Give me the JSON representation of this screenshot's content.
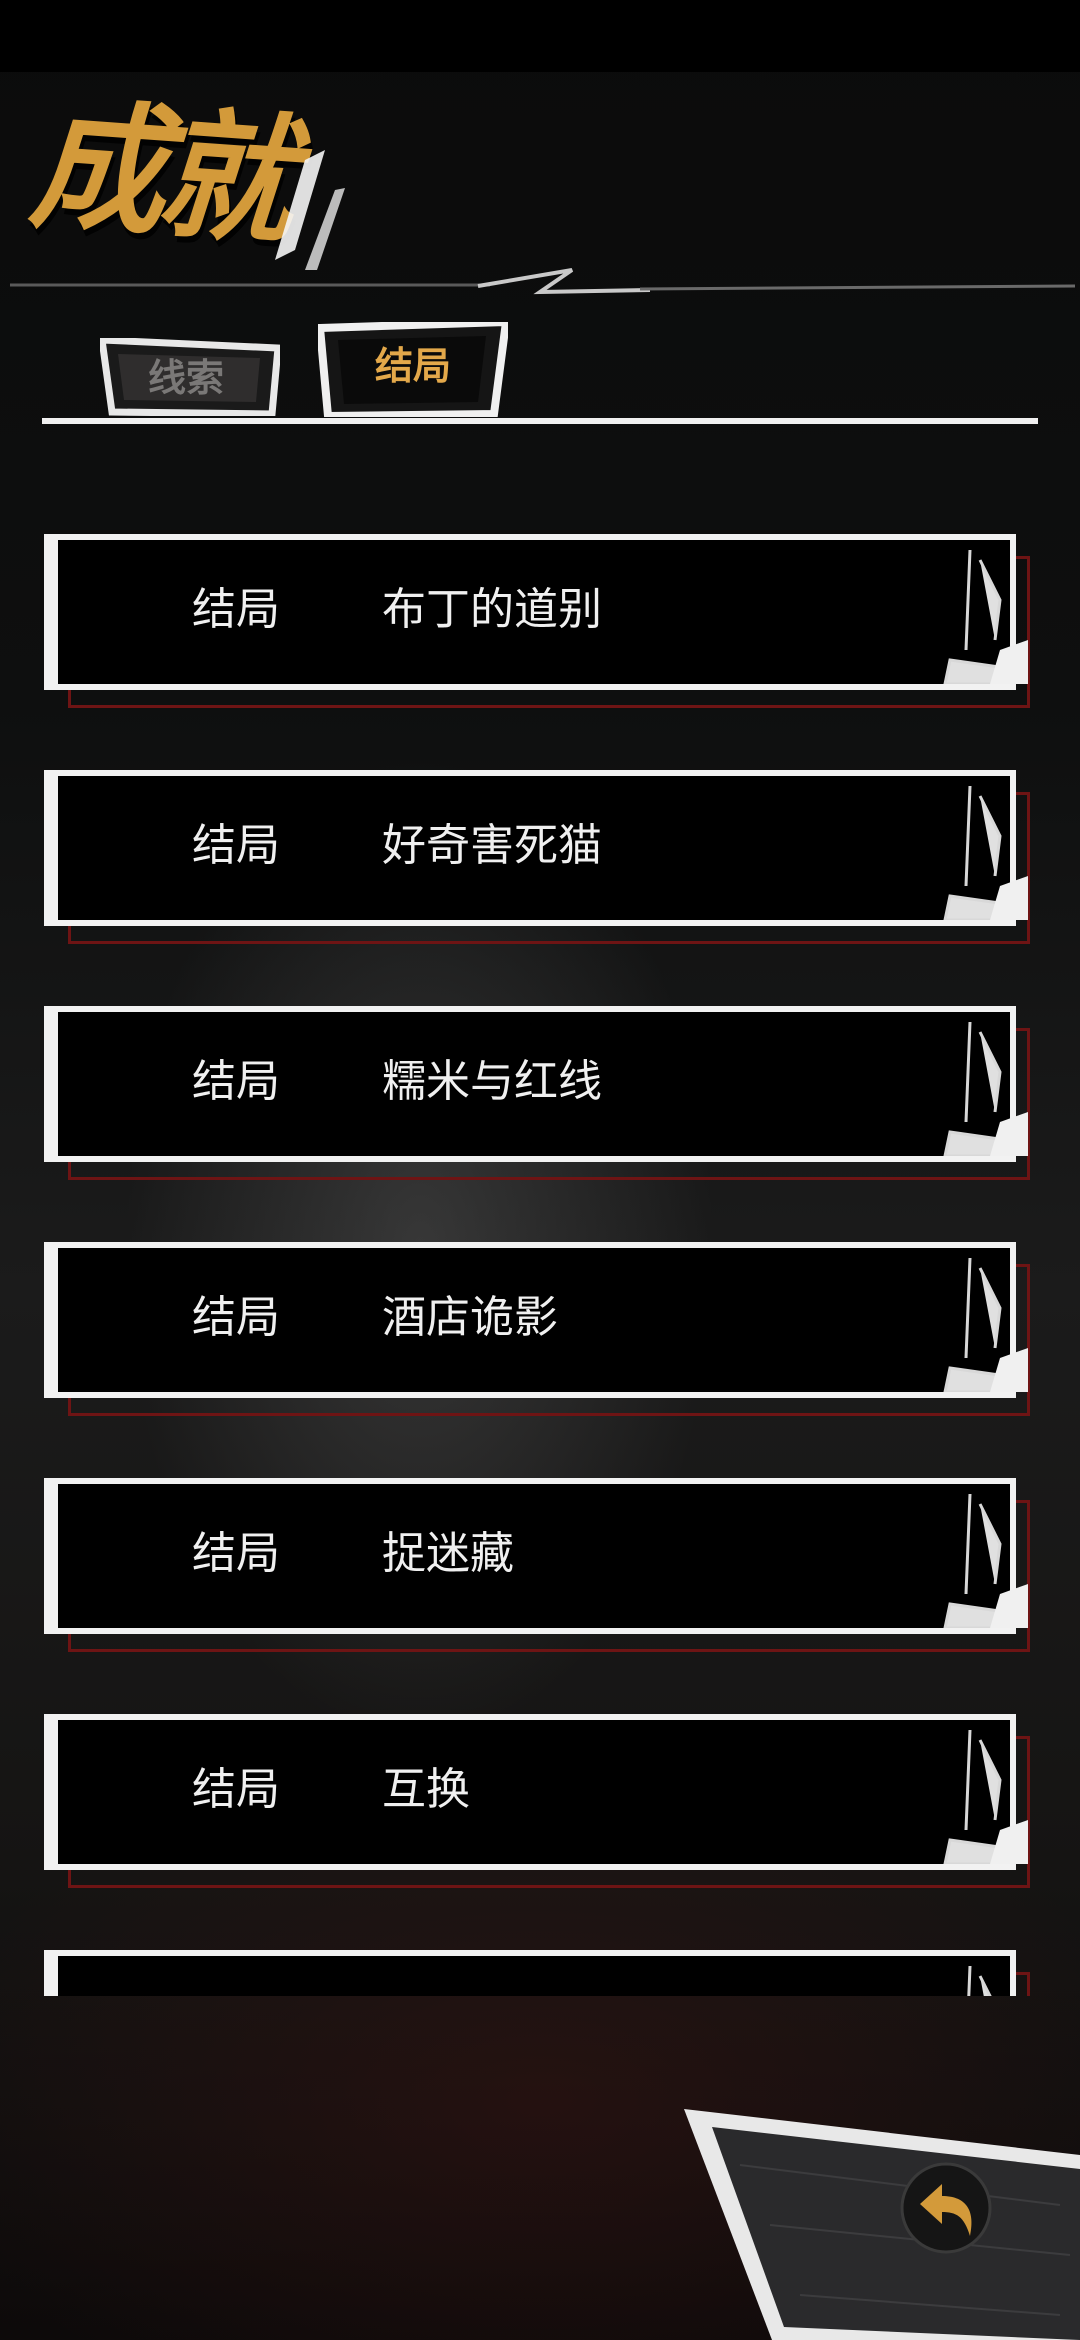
{
  "header": {
    "title": "成就"
  },
  "tabs": [
    {
      "label": "线索",
      "selected": false
    },
    {
      "label": "结局",
      "selected": true
    }
  ],
  "endings": [
    {
      "lead": "结局",
      "name": "布丁的道别"
    },
    {
      "lead": "结局",
      "name": "好奇害死猫"
    },
    {
      "lead": "结局",
      "name": "糯米与红线"
    },
    {
      "lead": "结局",
      "name": "酒店诡影"
    },
    {
      "lead": "结局",
      "name": "捉迷藏"
    },
    {
      "lead": "结局",
      "name": "互换"
    },
    {
      "lead": "",
      "name": ""
    }
  ],
  "colors": {
    "accent_gold": "#d39a3a",
    "tab_active": "#e3a84a",
    "tab_inactive": "#7a7877",
    "row_shadow_red": "#6e1414",
    "frame_white": "#f2f2f2"
  },
  "icons": {
    "back": "back-arrow-icon"
  }
}
